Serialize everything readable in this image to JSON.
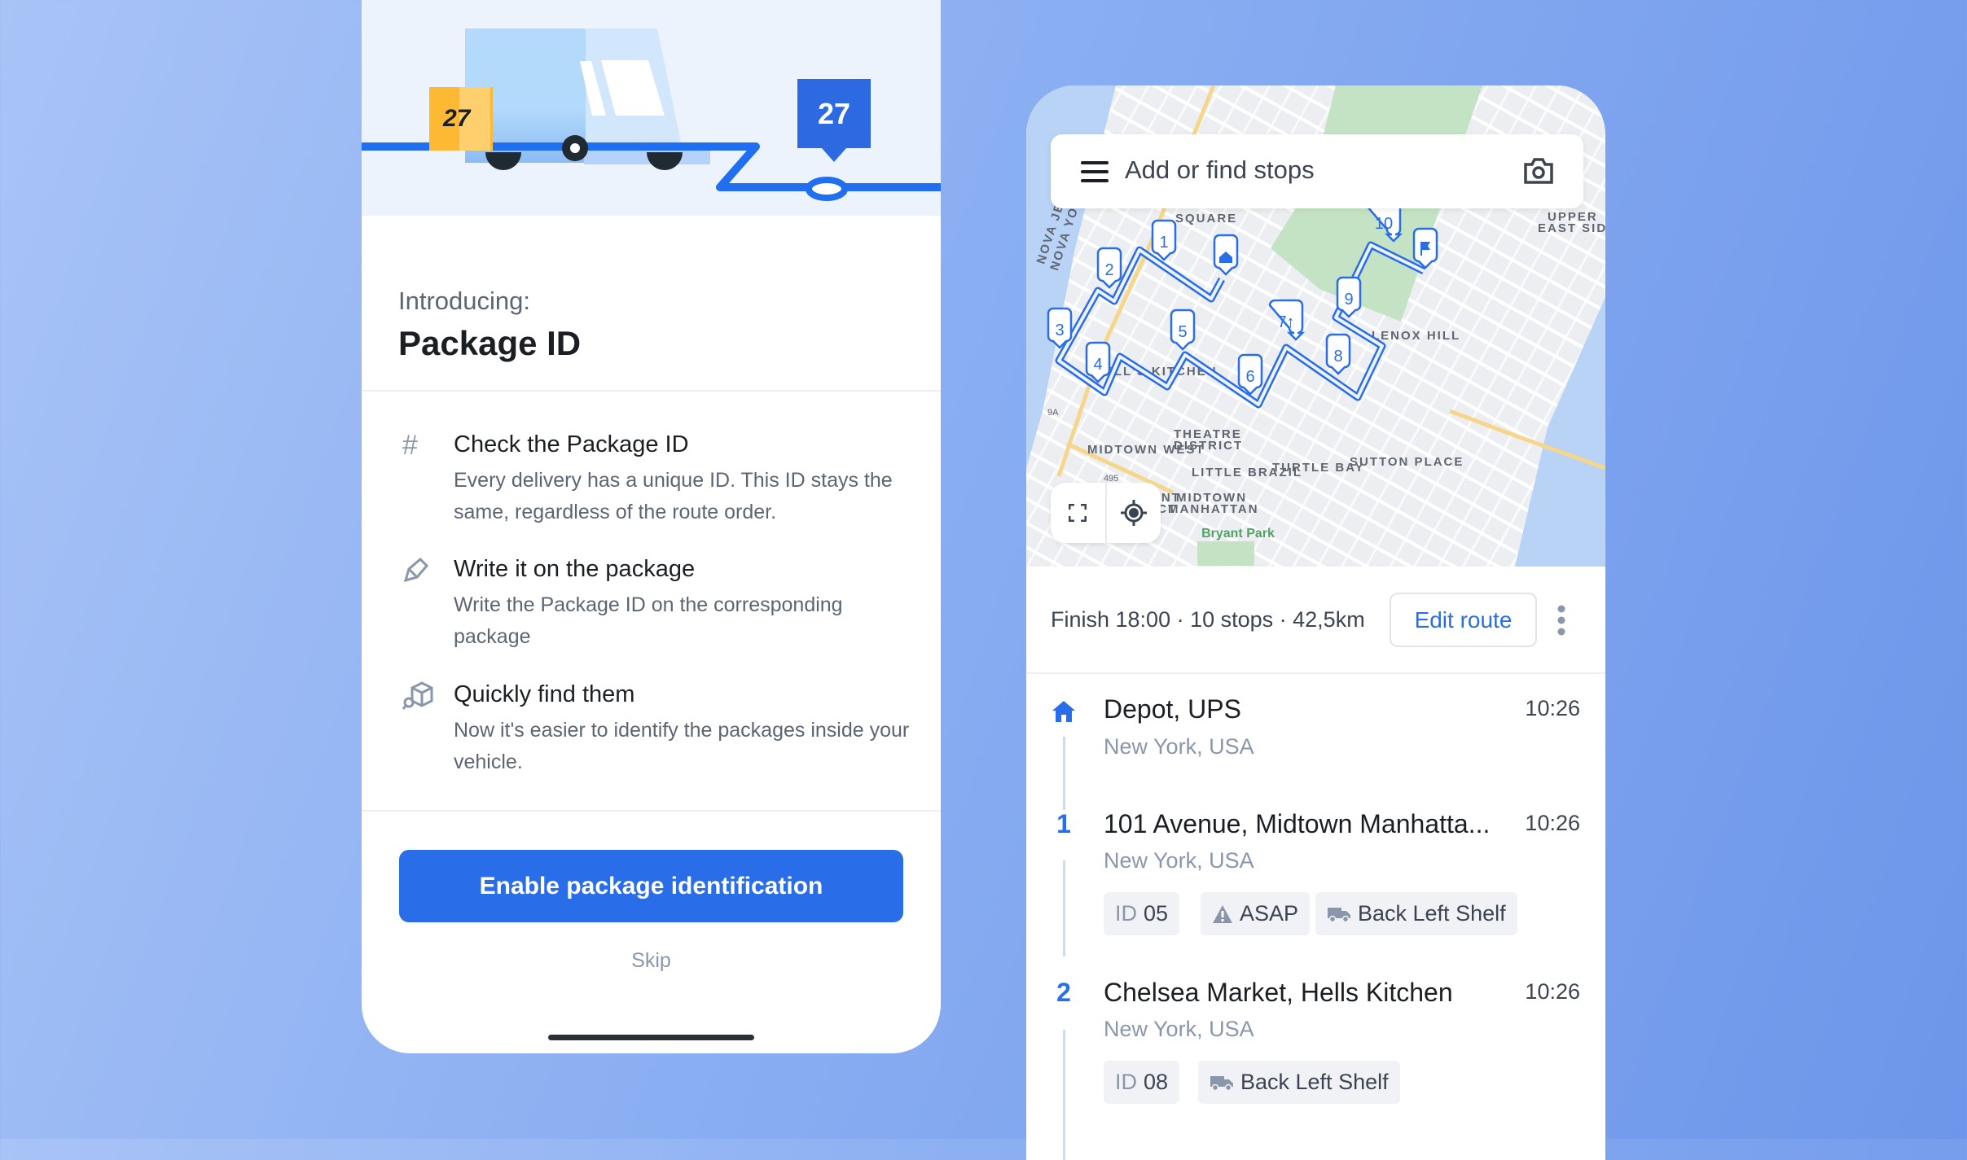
{
  "colors": {
    "accent": "#2a6de8",
    "background": "#8aaef2",
    "box": "#fdb933"
  },
  "onboarding": {
    "illustration": {
      "box_label": "27",
      "pin_label": "27"
    },
    "intro": "Introducing:",
    "title": "Package ID",
    "features": [
      {
        "icon": "hash-icon",
        "title": "Check the Package ID",
        "desc": "Every delivery has a unique ID. This ID stays the same, regardless of the route order."
      },
      {
        "icon": "pencil-icon",
        "title": "Write it on the package",
        "desc": "Write the Package ID on the corresponding package"
      },
      {
        "icon": "package-search-icon",
        "title": "Quickly find them",
        "desc": "Now it's easier to identify the packages inside your vehicle."
      }
    ],
    "cta": "Enable package identification",
    "skip": "Skip"
  },
  "route": {
    "search_placeholder": "Add or find stops",
    "map": {
      "labels": [
        "SQUARE",
        "UPPER",
        "EAST SIDE",
        "NOVA JERSEY",
        "NOVA YORK",
        "HELL'S KITCHEN",
        "MIDTOWN WEST",
        "THEATRE",
        "DISTRICT",
        "LITTLE BRAZIL",
        "TURTLE BAY",
        "SUTTON PLACE",
        "LENOX HILL",
        "MIDTOWN",
        "MANHATTAN",
        "GARMENT",
        "DISTRICT",
        "Bryant Park",
        "495",
        "9A"
      ],
      "markers": [
        "1",
        "2",
        "3",
        "4",
        "5",
        "6",
        "7↑",
        "8",
        "9",
        "10"
      ]
    },
    "summary": "Finish 18:00 · 10 stops · 42,5km",
    "edit_label": "Edit route",
    "stops": [
      {
        "num": "",
        "title": "Depot, UPS",
        "sub": "New York, USA",
        "time": "10:26",
        "chips": []
      },
      {
        "num": "1",
        "title": "101 Avenue, Midtown Manhatta...",
        "sub": "New York, USA",
        "time": "10:26",
        "chips": [
          {
            "type": "id",
            "label": "ID",
            "value": "05"
          },
          {
            "type": "warning",
            "value": "ASAP"
          },
          {
            "type": "truck",
            "value": "Back Left Shelf"
          }
        ]
      },
      {
        "num": "2",
        "title": "Chelsea Market, Hells Kitchen",
        "sub": "New York, USA",
        "time": "10:26",
        "chips": [
          {
            "type": "id",
            "label": "ID",
            "value": "08"
          },
          {
            "type": "truck",
            "value": "Back Left Shelf"
          }
        ]
      }
    ]
  }
}
